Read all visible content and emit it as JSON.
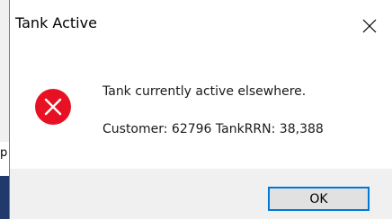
{
  "dialog": {
    "title": "Tank Active",
    "close_icon": "close-icon",
    "message": "Tank currently active elsewhere.",
    "detail": "Customer: 62796 TankRRN: 38,388",
    "icon": "error-icon",
    "ok_label": "OK"
  },
  "background": {
    "partial_text": "p"
  },
  "colors": {
    "error_red": "#e81123",
    "focus_blue": "#0078d7",
    "footer_gray": "#f0f0f0"
  }
}
